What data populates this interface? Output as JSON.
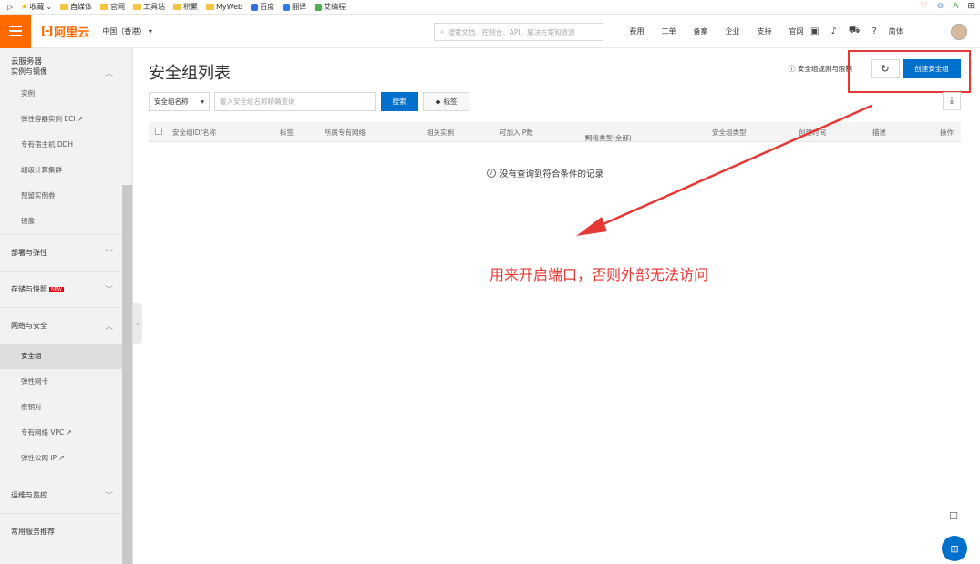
{
  "bookmarks": [
    {
      "label": "收藏",
      "icon": "star-icon"
    },
    {
      "label": "自媒体",
      "icon": "folder-icon"
    },
    {
      "label": "官网",
      "icon": "folder-icon"
    },
    {
      "label": "工具站",
      "icon": "folder-icon"
    },
    {
      "label": "积累",
      "icon": "folder-icon"
    },
    {
      "label": "MyWeb",
      "icon": "folder-icon"
    },
    {
      "label": "百度",
      "icon": "baidu-icon"
    },
    {
      "label": "翻译",
      "icon": "translate-icon"
    },
    {
      "label": "艾编程",
      "icon": "site-icon"
    }
  ],
  "header": {
    "logo": "阿里云",
    "region": "中国（香港）",
    "search_placeholder": "搜索文档、控制台、API、解决方案和资源",
    "nav": [
      "费用",
      "工单",
      "备案",
      "企业",
      "支持",
      "官网"
    ],
    "lang": "简体"
  },
  "sidebar": {
    "title": "云服务器",
    "group_instances": "实例与镜像",
    "instances": [
      "实例",
      "弹性容器实例 ECI",
      "专有宿主机 DDH",
      "超级计算集群",
      "预留实例券",
      "镜像"
    ],
    "group_deploy": "部署与弹性",
    "group_storage": "存储与快照",
    "new_badge": "NEW",
    "group_network": "网络与安全",
    "network": [
      "安全组",
      "弹性网卡",
      "密钥对",
      "专有网络 VPC",
      "弹性公网 IP"
    ],
    "group_ops": "运维与监控",
    "group_common": "常用服务推荐"
  },
  "main": {
    "title": "安全组列表",
    "help_link": "安全组规则与限制",
    "create_button": "创建安全组",
    "filter_select": "安全组名称",
    "search_placeholder": "输入安全组名称精确查询",
    "search_button": "搜索",
    "tag_button": "标签",
    "columns": [
      "安全组ID/名称",
      "标签",
      "所属专有网络",
      "相关实例",
      "可加入IP数",
      "网络类型(全部)",
      "安全组类型",
      "创建时间",
      "描述",
      "操作"
    ],
    "empty_text": "没有查询到符合条件的记录"
  },
  "annotation": "用来开启端口，否则外部无法访问",
  "colors": {
    "brand": "#ff6a00",
    "primary": "#0070cc",
    "annotation": "#e53935"
  }
}
